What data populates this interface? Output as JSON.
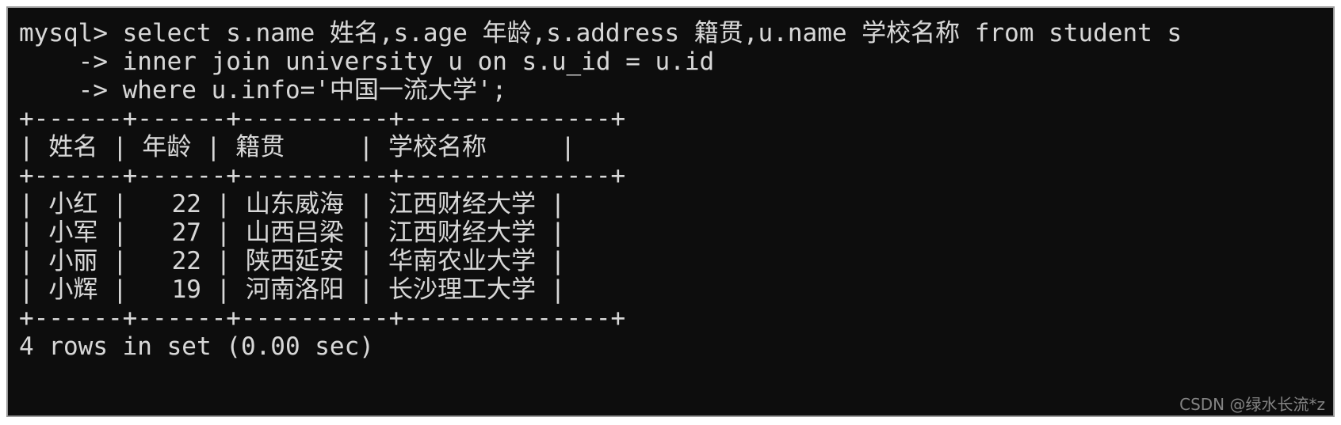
{
  "window": {
    "type": "terminal",
    "background_color": "#0d0d0d",
    "text_color": "#d7d7d7",
    "border_color": "#9a9a9a",
    "page_background": "#ffffff"
  },
  "terminal": {
    "prompt": "mysql>",
    "lines": [
      "mysql> select s.name 姓名,s.age 年龄,s.address 籍贯,u.name 学校名称 from student s",
      "    -> inner join university u on s.u_id = u.id",
      "    -> where u.info='中国一流大学';",
      "+------+------+----------+--------------+",
      "| 姓名 | 年龄 | 籍贯     | 学校名称     |",
      "+------+------+----------+--------------+",
      "| 小红 |   22 | 山东威海 | 江西财经大学 |",
      "| 小军 |   27 | 山西吕梁 | 江西财经大学 |",
      "| 小丽 |   22 | 陕西延安 | 华南农业大学 |",
      "| 小辉 |   19 | 河南洛阳 | 长沙理工大学 |",
      "+------+------+----------+--------------+",
      "4 rows in set (0.00 sec)"
    ]
  },
  "query": {
    "statement_lines": [
      "select s.name 姓名,s.age 年龄,s.address 籍贯,u.name 学校名称 from student s",
      "inner join university u on s.u_id = u.id",
      "where u.info='中国一流大学';"
    ],
    "continuation_prompt": "->",
    "tables": [
      "student",
      "university"
    ],
    "join_type": "inner join",
    "join_condition": "s.u_id = u.id",
    "where_condition": "u.info='中国一流大学'"
  },
  "result_table": {
    "border_row": "+------+------+----------+--------------+",
    "columns": [
      "姓名",
      "年龄",
      "籍贯",
      "学校名称"
    ],
    "header_row": "| 姓名 | 年龄 | 籍贯     | 学校名称     |",
    "rows": [
      {
        "text": "| 小红 |   22 | 山东威海 | 江西财经大学 |",
        "name": "小红",
        "age": "22",
        "address": "山东威海",
        "school": "江西财经大学"
      },
      {
        "text": "| 小军 |   27 | 山西吕梁 | 江西财经大学 |",
        "name": "小军",
        "age": "27",
        "address": "山西吕梁",
        "school": "江西财经大学"
      },
      {
        "text": "| 小丽 |   22 | 陕西延安 | 华南农业大学 |",
        "name": "小丽",
        "age": "22",
        "address": "陕西延安",
        "school": "华南农业大学"
      },
      {
        "text": "| 小辉 |   19 | 河南洛阳 | 长沙理工大学 |",
        "name": "小辉",
        "age": "19",
        "address": "河南洛阳",
        "school": "长沙理工大学"
      }
    ]
  },
  "status": {
    "text": "4 rows in set (0.00 sec)",
    "row_count": "4",
    "elapsed": "0.00 sec"
  },
  "watermark": {
    "text": "CSDN @绿水长流*z"
  }
}
